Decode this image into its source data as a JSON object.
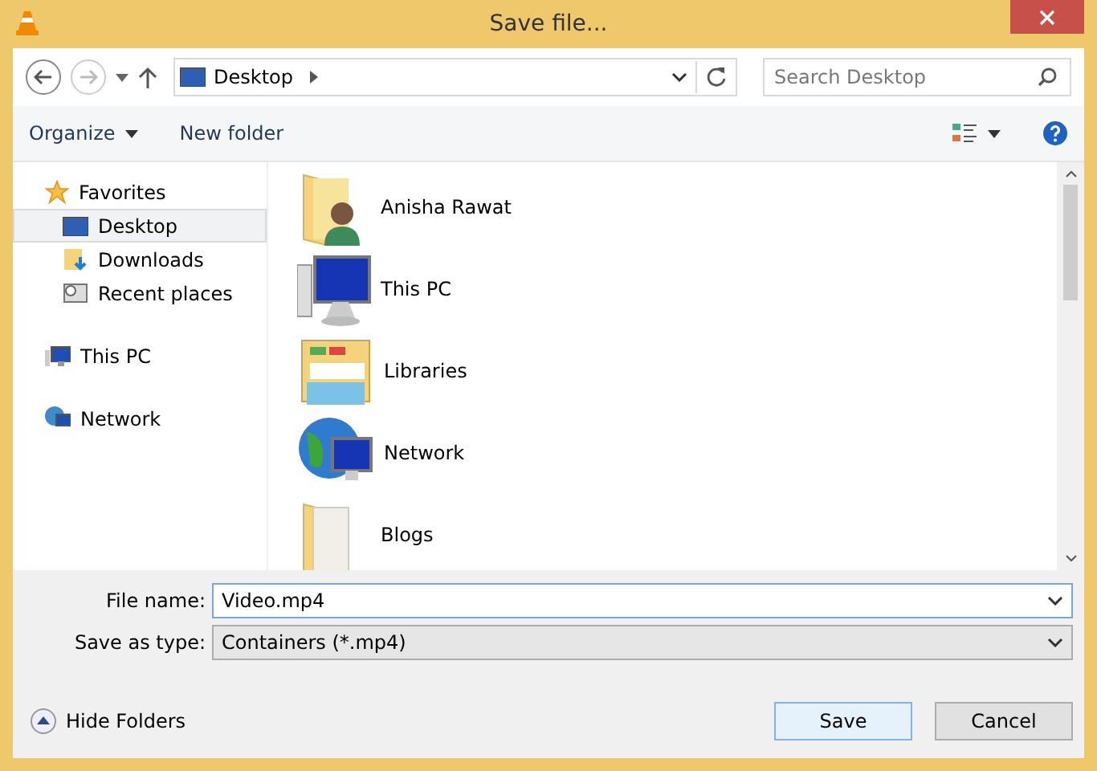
{
  "window": {
    "title": "Save file..."
  },
  "navigation": {
    "path": "Desktop",
    "search": {
      "placeholder": "Search Desktop"
    }
  },
  "toolbar": {
    "organize": "Organize",
    "new_folder": "New folder"
  },
  "sidebar": {
    "groups": [
      {
        "label": "Favorites",
        "kind": "favorites",
        "children": [
          {
            "label": "Desktop",
            "kind": "desktop",
            "selected": true
          },
          {
            "label": "Downloads",
            "kind": "downloads",
            "selected": false
          },
          {
            "label": "Recent places",
            "kind": "recent",
            "selected": false
          }
        ]
      },
      {
        "label": "This PC",
        "kind": "pc"
      },
      {
        "label": "Network",
        "kind": "network"
      }
    ]
  },
  "items": [
    {
      "label": "Anisha Rawat",
      "kind": "user"
    },
    {
      "label": "This PC",
      "kind": "pc"
    },
    {
      "label": "Libraries",
      "kind": "libraries"
    },
    {
      "label": "Network",
      "kind": "network"
    },
    {
      "label": "Blogs",
      "kind": "folder"
    }
  ],
  "form": {
    "file_name": {
      "label": "File name:",
      "value": "Video.mp4"
    },
    "save_as_type": {
      "label": "Save as type:",
      "value": "Containers (*.mp4)"
    }
  },
  "hide_folders": "Hide Folders",
  "buttons": [
    {
      "label": "Save",
      "kind": "primary"
    },
    {
      "label": "Cancel",
      "kind": "normal"
    }
  ]
}
